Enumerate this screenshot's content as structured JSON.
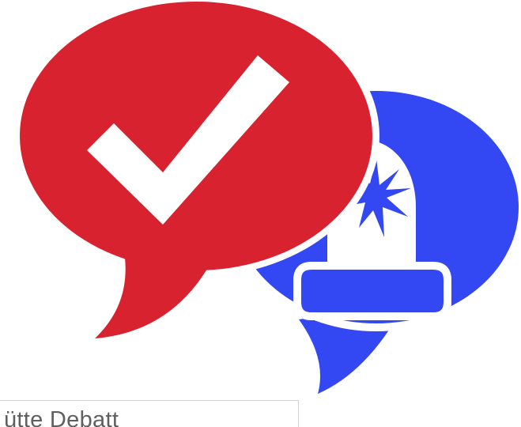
{
  "logo": {
    "icons": [
      "checkmark-speech-bubble-icon",
      "police-siren-speech-bubble-icon"
    ],
    "colors": {
      "red_bubble": "#d8222f",
      "blue_bubble": "#3347f2",
      "background": "#ffffff",
      "icon_white": "#ffffff"
    }
  },
  "field": {
    "visible_text": "ütte Debatt"
  }
}
